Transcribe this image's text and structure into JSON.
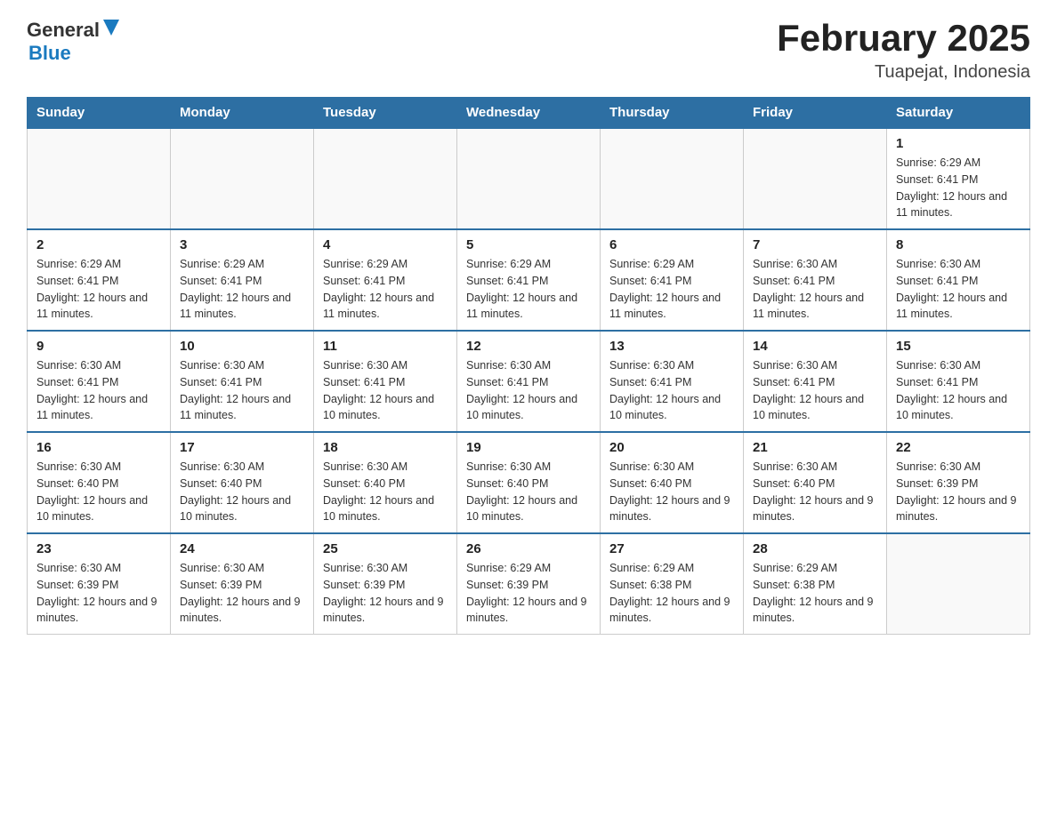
{
  "header": {
    "logo_general": "General",
    "logo_blue": "Blue",
    "month_title": "February 2025",
    "location": "Tuapejat, Indonesia"
  },
  "days_of_week": [
    "Sunday",
    "Monday",
    "Tuesday",
    "Wednesday",
    "Thursday",
    "Friday",
    "Saturday"
  ],
  "weeks": [
    {
      "cells": [
        {
          "empty": true
        },
        {
          "empty": true
        },
        {
          "empty": true
        },
        {
          "empty": true
        },
        {
          "empty": true
        },
        {
          "empty": true
        },
        {
          "day": "1",
          "sunrise": "Sunrise: 6:29 AM",
          "sunset": "Sunset: 6:41 PM",
          "daylight": "Daylight: 12 hours and 11 minutes."
        }
      ]
    },
    {
      "cells": [
        {
          "day": "2",
          "sunrise": "Sunrise: 6:29 AM",
          "sunset": "Sunset: 6:41 PM",
          "daylight": "Daylight: 12 hours and 11 minutes."
        },
        {
          "day": "3",
          "sunrise": "Sunrise: 6:29 AM",
          "sunset": "Sunset: 6:41 PM",
          "daylight": "Daylight: 12 hours and 11 minutes."
        },
        {
          "day": "4",
          "sunrise": "Sunrise: 6:29 AM",
          "sunset": "Sunset: 6:41 PM",
          "daylight": "Daylight: 12 hours and 11 minutes."
        },
        {
          "day": "5",
          "sunrise": "Sunrise: 6:29 AM",
          "sunset": "Sunset: 6:41 PM",
          "daylight": "Daylight: 12 hours and 11 minutes."
        },
        {
          "day": "6",
          "sunrise": "Sunrise: 6:29 AM",
          "sunset": "Sunset: 6:41 PM",
          "daylight": "Daylight: 12 hours and 11 minutes."
        },
        {
          "day": "7",
          "sunrise": "Sunrise: 6:30 AM",
          "sunset": "Sunset: 6:41 PM",
          "daylight": "Daylight: 12 hours and 11 minutes."
        },
        {
          "day": "8",
          "sunrise": "Sunrise: 6:30 AM",
          "sunset": "Sunset: 6:41 PM",
          "daylight": "Daylight: 12 hours and 11 minutes."
        }
      ]
    },
    {
      "cells": [
        {
          "day": "9",
          "sunrise": "Sunrise: 6:30 AM",
          "sunset": "Sunset: 6:41 PM",
          "daylight": "Daylight: 12 hours and 11 minutes."
        },
        {
          "day": "10",
          "sunrise": "Sunrise: 6:30 AM",
          "sunset": "Sunset: 6:41 PM",
          "daylight": "Daylight: 12 hours and 11 minutes."
        },
        {
          "day": "11",
          "sunrise": "Sunrise: 6:30 AM",
          "sunset": "Sunset: 6:41 PM",
          "daylight": "Daylight: 12 hours and 10 minutes."
        },
        {
          "day": "12",
          "sunrise": "Sunrise: 6:30 AM",
          "sunset": "Sunset: 6:41 PM",
          "daylight": "Daylight: 12 hours and 10 minutes."
        },
        {
          "day": "13",
          "sunrise": "Sunrise: 6:30 AM",
          "sunset": "Sunset: 6:41 PM",
          "daylight": "Daylight: 12 hours and 10 minutes."
        },
        {
          "day": "14",
          "sunrise": "Sunrise: 6:30 AM",
          "sunset": "Sunset: 6:41 PM",
          "daylight": "Daylight: 12 hours and 10 minutes."
        },
        {
          "day": "15",
          "sunrise": "Sunrise: 6:30 AM",
          "sunset": "Sunset: 6:41 PM",
          "daylight": "Daylight: 12 hours and 10 minutes."
        }
      ]
    },
    {
      "cells": [
        {
          "day": "16",
          "sunrise": "Sunrise: 6:30 AM",
          "sunset": "Sunset: 6:40 PM",
          "daylight": "Daylight: 12 hours and 10 minutes."
        },
        {
          "day": "17",
          "sunrise": "Sunrise: 6:30 AM",
          "sunset": "Sunset: 6:40 PM",
          "daylight": "Daylight: 12 hours and 10 minutes."
        },
        {
          "day": "18",
          "sunrise": "Sunrise: 6:30 AM",
          "sunset": "Sunset: 6:40 PM",
          "daylight": "Daylight: 12 hours and 10 minutes."
        },
        {
          "day": "19",
          "sunrise": "Sunrise: 6:30 AM",
          "sunset": "Sunset: 6:40 PM",
          "daylight": "Daylight: 12 hours and 10 minutes."
        },
        {
          "day": "20",
          "sunrise": "Sunrise: 6:30 AM",
          "sunset": "Sunset: 6:40 PM",
          "daylight": "Daylight: 12 hours and 9 minutes."
        },
        {
          "day": "21",
          "sunrise": "Sunrise: 6:30 AM",
          "sunset": "Sunset: 6:40 PM",
          "daylight": "Daylight: 12 hours and 9 minutes."
        },
        {
          "day": "22",
          "sunrise": "Sunrise: 6:30 AM",
          "sunset": "Sunset: 6:39 PM",
          "daylight": "Daylight: 12 hours and 9 minutes."
        }
      ]
    },
    {
      "cells": [
        {
          "day": "23",
          "sunrise": "Sunrise: 6:30 AM",
          "sunset": "Sunset: 6:39 PM",
          "daylight": "Daylight: 12 hours and 9 minutes."
        },
        {
          "day": "24",
          "sunrise": "Sunrise: 6:30 AM",
          "sunset": "Sunset: 6:39 PM",
          "daylight": "Daylight: 12 hours and 9 minutes."
        },
        {
          "day": "25",
          "sunrise": "Sunrise: 6:30 AM",
          "sunset": "Sunset: 6:39 PM",
          "daylight": "Daylight: 12 hours and 9 minutes."
        },
        {
          "day": "26",
          "sunrise": "Sunrise: 6:29 AM",
          "sunset": "Sunset: 6:39 PM",
          "daylight": "Daylight: 12 hours and 9 minutes."
        },
        {
          "day": "27",
          "sunrise": "Sunrise: 6:29 AM",
          "sunset": "Sunset: 6:38 PM",
          "daylight": "Daylight: 12 hours and 9 minutes."
        },
        {
          "day": "28",
          "sunrise": "Sunrise: 6:29 AM",
          "sunset": "Sunset: 6:38 PM",
          "daylight": "Daylight: 12 hours and 9 minutes."
        },
        {
          "empty": true
        }
      ]
    }
  ]
}
